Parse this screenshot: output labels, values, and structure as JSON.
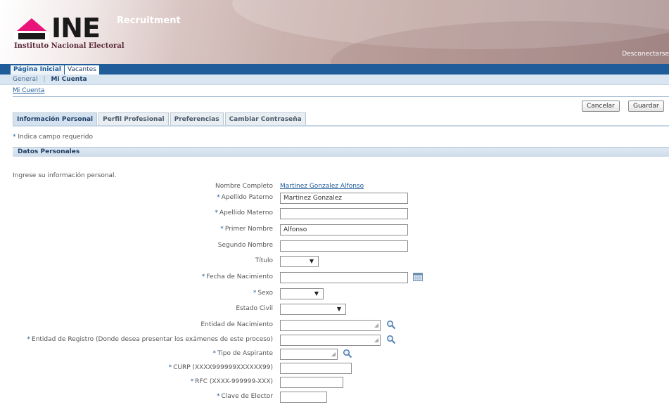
{
  "header": {
    "logo_text": "INE",
    "logo_subtitle": "Instituto Nacional Electoral",
    "app_name": "Recruitment",
    "logout_label": "Desconectarse"
  },
  "nav": {
    "tabs": [
      {
        "label": "Página Inicial"
      },
      {
        "label": "Vacantes"
      }
    ]
  },
  "subnav": {
    "items": [
      "General",
      "Mi Cuenta"
    ]
  },
  "breadcrumb": "Mi Cuenta",
  "actions": {
    "cancel_label": "Cancelar",
    "save_label": "Guardar"
  },
  "subtabs": [
    {
      "label": "Información Personal"
    },
    {
      "label": "Perfil Profesional"
    },
    {
      "label": "Preferencias"
    },
    {
      "label": "Cambiar Contraseña"
    }
  ],
  "required_note": "Indica campo requerido",
  "section_title": "Datos Personales",
  "intro": "Ingrese su información personal.",
  "form": {
    "nombre_completo": {
      "label": "Nombre Completo",
      "value": "Martinez Gonzalez Alfonso"
    },
    "apellido_paterno": {
      "label": "Apellido Paterno",
      "value": "Martinez Gonzalez"
    },
    "apellido_materno": {
      "label": "Apellido Materno",
      "value": ""
    },
    "primer_nombre": {
      "label": "Primer Nombre",
      "value": "Alfonso"
    },
    "segundo_nombre": {
      "label": "Segundo Nombre",
      "value": ""
    },
    "titulo": {
      "label": "Título",
      "value": ""
    },
    "fecha_nacimiento": {
      "label": "Fecha de Nacimiento",
      "value": ""
    },
    "sexo": {
      "label": "Sexo",
      "value": ""
    },
    "estado_civil": {
      "label": "Estado Civil",
      "value": ""
    },
    "entidad_nacimiento": {
      "label": "Entidad de Nacimiento",
      "value": ""
    },
    "entidad_registro": {
      "label": "Entidad de Registro (Donde desea presentar los exámenes de este proceso)",
      "value": ""
    },
    "tipo_aspirante": {
      "label": "Tipo de Aspirante",
      "value": ""
    },
    "curp": {
      "label": "CURP (XXXX999999XXXXXX99)",
      "value": ""
    },
    "rfc": {
      "label": "RFC (XXXX-999999-XXX)",
      "value": ""
    },
    "clave_elector": {
      "label": "Clave de Elector",
      "value": ""
    }
  },
  "required_marker": "*",
  "colors": {
    "nav_blue": "#1f5c99",
    "logo_pink": "#e8147a",
    "link": "#1f5c99"
  }
}
